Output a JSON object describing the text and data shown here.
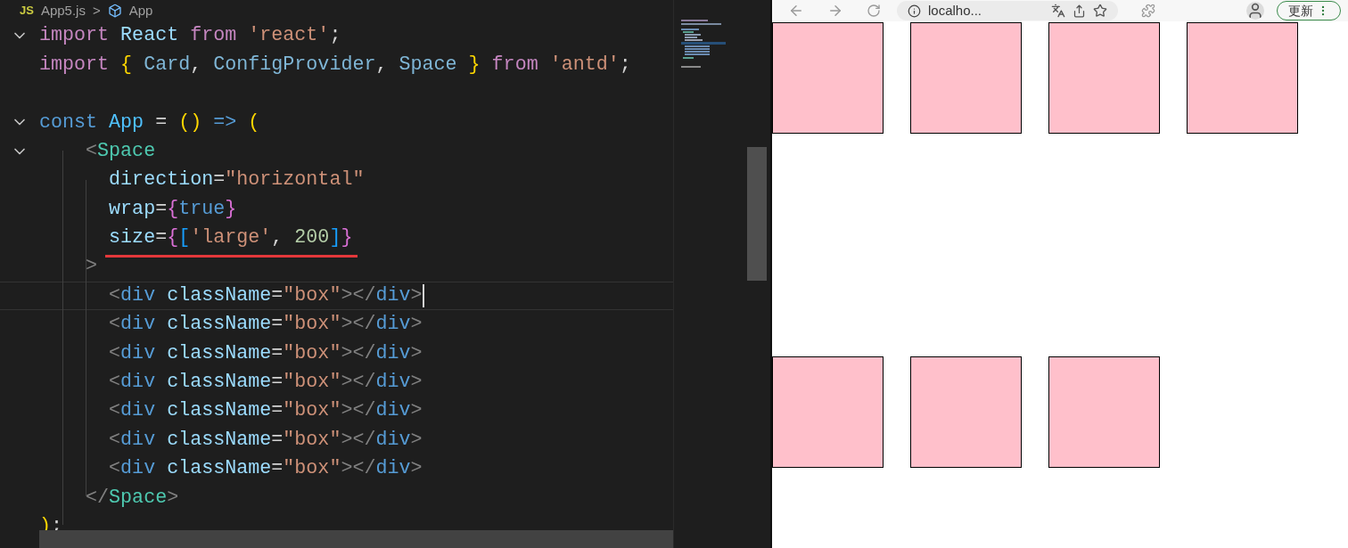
{
  "editor": {
    "breadcrumb": {
      "file_badge": "JS",
      "file": "App5.js",
      "separator": ">",
      "symbol": "App"
    },
    "lines": [
      {
        "kind": "code",
        "expanded": true,
        "tokens": [
          {
            "kind": "kw",
            "text": "import "
          },
          {
            "kind": "var",
            "text": "React "
          },
          {
            "kind": "kw",
            "text": "from "
          },
          {
            "kind": "str",
            "text": "'react'"
          },
          {
            "kind": "punc",
            "text": ";"
          }
        ]
      },
      {
        "kind": "code",
        "tokens": [
          {
            "kind": "kw",
            "text": "import "
          },
          {
            "kind": "brace1",
            "text": "{ "
          },
          {
            "kind": "type",
            "text": "Card"
          },
          {
            "kind": "punc",
            "text": ", "
          },
          {
            "kind": "type",
            "text": "ConfigProvider"
          },
          {
            "kind": "punc",
            "text": ", "
          },
          {
            "kind": "type",
            "text": "Space "
          },
          {
            "kind": "brace1",
            "text": "} "
          },
          {
            "kind": "kw",
            "text": "from "
          },
          {
            "kind": "str",
            "text": "'antd'"
          },
          {
            "kind": "punc",
            "text": ";"
          }
        ]
      },
      {
        "kind": "blank"
      },
      {
        "kind": "code",
        "expanded": true,
        "tokens": [
          {
            "kind": "decl",
            "text": "const "
          },
          {
            "kind": "fn",
            "text": "App "
          },
          {
            "kind": "punc",
            "text": "= "
          },
          {
            "kind": "brace1",
            "text": "() "
          },
          {
            "kind": "decl",
            "text": "=> "
          },
          {
            "kind": "brace1",
            "text": "("
          }
        ]
      },
      {
        "kind": "code",
        "expanded": true,
        "tokens": [
          {
            "kind": "tag",
            "text": "    <"
          },
          {
            "kind": "comp",
            "text": "Space"
          }
        ]
      },
      {
        "kind": "code",
        "tokens": [
          {
            "kind": "attr",
            "text": "      direction"
          },
          {
            "kind": "punc",
            "text": "="
          },
          {
            "kind": "str",
            "text": "\"horizontal\""
          }
        ]
      },
      {
        "kind": "code",
        "tokens": [
          {
            "kind": "attr",
            "text": "      wrap"
          },
          {
            "kind": "punc",
            "text": "="
          },
          {
            "kind": "brace2",
            "text": "{"
          },
          {
            "kind": "decl",
            "text": "true"
          },
          {
            "kind": "brace2",
            "text": "}"
          }
        ]
      },
      {
        "kind": "code",
        "underlined": true,
        "tokens": [
          {
            "kind": "attr",
            "text": "      size"
          },
          {
            "kind": "punc",
            "text": "="
          },
          {
            "kind": "brace2",
            "text": "{"
          },
          {
            "kind": "brace3",
            "text": "["
          },
          {
            "kind": "str",
            "text": "'large'"
          },
          {
            "kind": "punc",
            "text": ", "
          },
          {
            "kind": "num",
            "text": "200"
          },
          {
            "kind": "brace3",
            "text": "]"
          },
          {
            "kind": "brace2",
            "text": "}"
          }
        ]
      },
      {
        "kind": "code",
        "tokens": [
          {
            "kind": "tag",
            "text": "    >"
          }
        ]
      },
      {
        "kind": "code",
        "current": true,
        "tokens": [
          {
            "kind": "tag",
            "text": "      <"
          },
          {
            "kind": "decl",
            "text": "div "
          },
          {
            "kind": "attr",
            "text": "className"
          },
          {
            "kind": "punc",
            "text": "="
          },
          {
            "kind": "str",
            "text": "\"box\""
          },
          {
            "kind": "tag",
            "text": "></"
          },
          {
            "kind": "decl",
            "text": "div"
          },
          {
            "kind": "tag",
            "text": ">"
          }
        ]
      },
      {
        "kind": "code",
        "tokens": [
          {
            "kind": "tag",
            "text": "      <"
          },
          {
            "kind": "decl",
            "text": "div "
          },
          {
            "kind": "attr",
            "text": "className"
          },
          {
            "kind": "punc",
            "text": "="
          },
          {
            "kind": "str",
            "text": "\"box\""
          },
          {
            "kind": "tag",
            "text": "></"
          },
          {
            "kind": "decl",
            "text": "div"
          },
          {
            "kind": "tag",
            "text": ">"
          }
        ]
      },
      {
        "kind": "code",
        "tokens": [
          {
            "kind": "tag",
            "text": "      <"
          },
          {
            "kind": "decl",
            "text": "div "
          },
          {
            "kind": "attr",
            "text": "className"
          },
          {
            "kind": "punc",
            "text": "="
          },
          {
            "kind": "str",
            "text": "\"box\""
          },
          {
            "kind": "tag",
            "text": "></"
          },
          {
            "kind": "decl",
            "text": "div"
          },
          {
            "kind": "tag",
            "text": ">"
          }
        ]
      },
      {
        "kind": "code",
        "tokens": [
          {
            "kind": "tag",
            "text": "      <"
          },
          {
            "kind": "decl",
            "text": "div "
          },
          {
            "kind": "attr",
            "text": "className"
          },
          {
            "kind": "punc",
            "text": "="
          },
          {
            "kind": "str",
            "text": "\"box\""
          },
          {
            "kind": "tag",
            "text": "></"
          },
          {
            "kind": "decl",
            "text": "div"
          },
          {
            "kind": "tag",
            "text": ">"
          }
        ]
      },
      {
        "kind": "code",
        "tokens": [
          {
            "kind": "tag",
            "text": "      <"
          },
          {
            "kind": "decl",
            "text": "div "
          },
          {
            "kind": "attr",
            "text": "className"
          },
          {
            "kind": "punc",
            "text": "="
          },
          {
            "kind": "str",
            "text": "\"box\""
          },
          {
            "kind": "tag",
            "text": "></"
          },
          {
            "kind": "decl",
            "text": "div"
          },
          {
            "kind": "tag",
            "text": ">"
          }
        ]
      },
      {
        "kind": "code",
        "tokens": [
          {
            "kind": "tag",
            "text": "      <"
          },
          {
            "kind": "decl",
            "text": "div "
          },
          {
            "kind": "attr",
            "text": "className"
          },
          {
            "kind": "punc",
            "text": "="
          },
          {
            "kind": "str",
            "text": "\"box\""
          },
          {
            "kind": "tag",
            "text": "></"
          },
          {
            "kind": "decl",
            "text": "div"
          },
          {
            "kind": "tag",
            "text": ">"
          }
        ]
      },
      {
        "kind": "code",
        "tokens": [
          {
            "kind": "tag",
            "text": "      <"
          },
          {
            "kind": "decl",
            "text": "div "
          },
          {
            "kind": "attr",
            "text": "className"
          },
          {
            "kind": "punc",
            "text": "="
          },
          {
            "kind": "str",
            "text": "\"box\""
          },
          {
            "kind": "tag",
            "text": "></"
          },
          {
            "kind": "decl",
            "text": "div"
          },
          {
            "kind": "tag",
            "text": ">"
          }
        ]
      },
      {
        "kind": "code",
        "tokens": [
          {
            "kind": "tag",
            "text": "    </"
          },
          {
            "kind": "comp",
            "text": "Space"
          },
          {
            "kind": "tag",
            "text": ">"
          }
        ]
      },
      {
        "kind": "code",
        "tokens": [
          {
            "kind": "brace1",
            "text": ")"
          },
          {
            "kind": "punc",
            "text": ";"
          }
        ]
      }
    ]
  },
  "browser": {
    "address": "localho...",
    "update_button": "更新",
    "boxes": [
      {
        "kind": "box"
      },
      {
        "kind": "box"
      },
      {
        "kind": "box"
      },
      {
        "kind": "box"
      },
      {
        "kind": "box"
      },
      {
        "kind": "box"
      },
      {
        "kind": "box"
      }
    ]
  }
}
